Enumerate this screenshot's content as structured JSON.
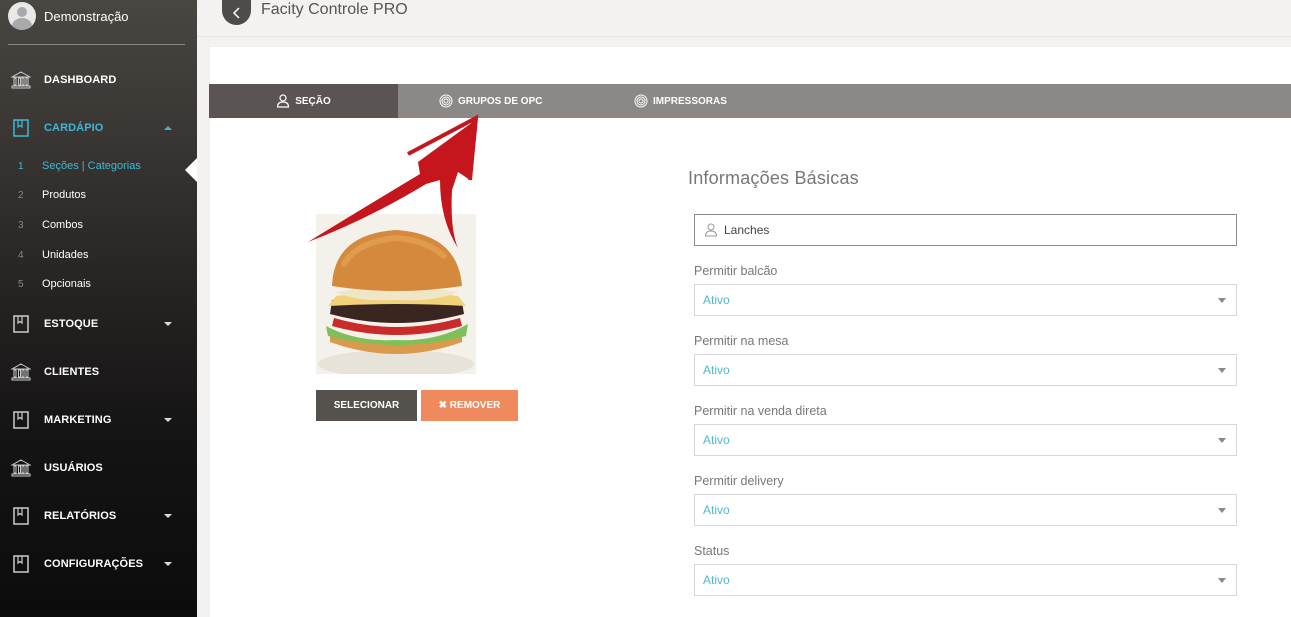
{
  "profile": {
    "name": "Demonstração"
  },
  "sidebar": {
    "items": [
      {
        "label": "DASHBOARD",
        "icon": "bank-icon"
      },
      {
        "label": "CARDÁPIO",
        "icon": "book-icon"
      },
      {
        "label": "ESTOQUE",
        "icon": "book-icon"
      },
      {
        "label": "CLIENTES",
        "icon": "bank-icon"
      },
      {
        "label": "MARKETING",
        "icon": "book-icon"
      },
      {
        "label": "USUÁRIOS",
        "icon": "bank-icon"
      },
      {
        "label": "RELATÓRIOS",
        "icon": "book-icon"
      },
      {
        "label": "CONFIGURAÇÕES",
        "icon": "book-icon"
      }
    ],
    "submenu": [
      {
        "num": "1",
        "label": "Seções | Categorias"
      },
      {
        "num": "2",
        "label": "Produtos"
      },
      {
        "num": "3",
        "label": "Combos"
      },
      {
        "num": "4",
        "label": "Unidades"
      },
      {
        "num": "5",
        "label": "Opcionais"
      }
    ]
  },
  "header": {
    "title": "Facity Controle PRO"
  },
  "tabs": [
    {
      "label": "SEÇÃO",
      "icon": "user-icon"
    },
    {
      "label": "GRUPOS DE OPC",
      "icon": "fingerprint-icon"
    },
    {
      "label": "IMPRESSORAS",
      "icon": "fingerprint-icon"
    }
  ],
  "image": {
    "select_label": "SELECIONAR",
    "remove_label": "✖ REMOVER"
  },
  "form": {
    "title": "Informações Básicas",
    "name_value": "Lanches",
    "fields": [
      {
        "label": "Permitir balcão",
        "value": "Ativo"
      },
      {
        "label": "Permitir na mesa",
        "value": "Ativo"
      },
      {
        "label": "Permitir na venda direta",
        "value": "Ativo"
      },
      {
        "label": "Permitir delivery",
        "value": "Ativo"
      },
      {
        "label": "Status",
        "value": "Ativo"
      }
    ]
  },
  "colors": {
    "accent": "#3fb8d8",
    "remove": "#ef8a5f",
    "dark": "#55514d",
    "annotation": "#c4161c"
  }
}
